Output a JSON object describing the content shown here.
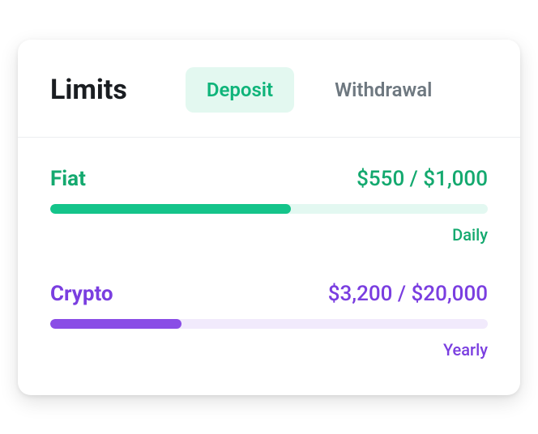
{
  "title": "Limits",
  "tabs": {
    "deposit": "Deposit",
    "withdrawal": "Withdrawal"
  },
  "fiat": {
    "label": "Fiat",
    "value": "$550 / $1,000",
    "period": "Daily",
    "fillPercent": "55%"
  },
  "crypto": {
    "label": "Crypto",
    "value": "$3,200 / $20,000",
    "period": "Yearly",
    "fillPercent": "30%"
  }
}
